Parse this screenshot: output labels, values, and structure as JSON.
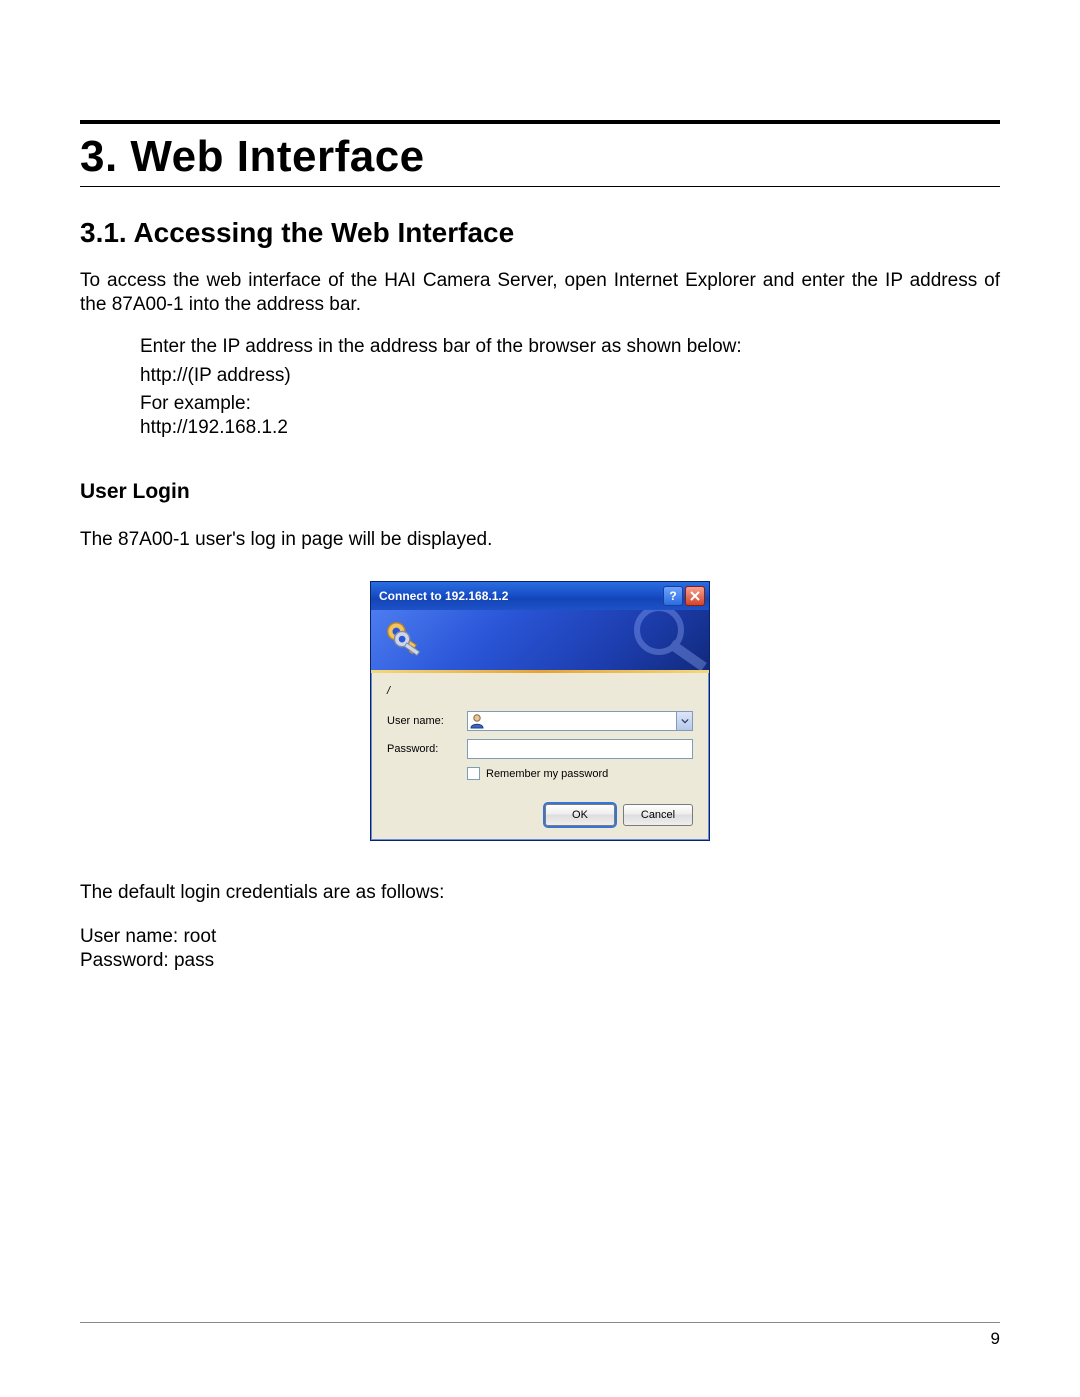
{
  "chapter_title": "3. Web Interface",
  "section_title": "3.1.  Accessing the Web Interface",
  "intro_paragraph": "To access the web interface of the HAI Camera Server, open Internet Explorer and enter the IP address of the 87A00-1 into the address bar.",
  "instruction_line": "Enter the IP address in the address bar of the browser as shown below:",
  "url_template": "http://(IP address)",
  "example_label": "For example:",
  "example_url": "http://192.168.1.2",
  "user_login_heading": "User Login",
  "user_login_desc": "The 87A00-1 user's log in page will be displayed.",
  "dialog": {
    "title": "Connect to 192.168.1.2",
    "realm": "/",
    "username_label": "User name:",
    "password_label": "Password:",
    "remember_label": "Remember my password",
    "ok_label": "OK",
    "cancel_label": "Cancel"
  },
  "default_creds_intro": "The default login credentials are as follows:",
  "default_username_line": "User name: root",
  "default_password_line": "Password: pass",
  "page_number": "9"
}
